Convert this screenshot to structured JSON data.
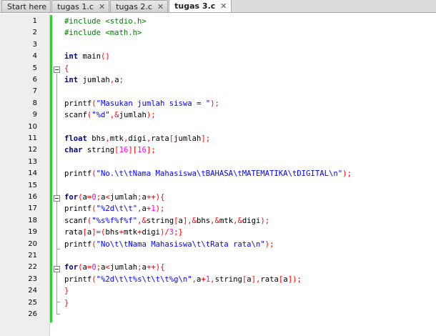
{
  "tabs": [
    {
      "label": "Start here",
      "active": false
    },
    {
      "label": "tugas 1.c",
      "active": false
    },
    {
      "label": "tugas 2.c",
      "active": false
    },
    {
      "label": "tugas 3.c",
      "active": true
    }
  ],
  "close_glyph": "✕",
  "editor": {
    "line_numbers": [
      "1",
      "2",
      "3",
      "4",
      "5",
      "6",
      "7",
      "8",
      "9",
      "10",
      "11",
      "12",
      "13",
      "14",
      "15",
      "16",
      "17",
      "18",
      "19",
      "20",
      "21",
      "22",
      "23",
      "24",
      "25",
      "26"
    ],
    "colors": {
      "keyword": "#00008b",
      "preprocessor": "#008000",
      "string": "#0000ff",
      "number": "#ff00ff",
      "operator": "#ff0000",
      "change_bar": "#33cc33",
      "gutter": "#eeeeee"
    },
    "code": {
      "l1": {
        "a": "#include <stdio.h>"
      },
      "l2": {
        "a": "#include <math.h>"
      },
      "l4": {
        "a": "int",
        "b": " main",
        "c": "()"
      },
      "l5": {
        "a": "{"
      },
      "l6": {
        "a": "int",
        "b": " jumlah",
        "c": ",",
        "d": "a",
        "e": ";"
      },
      "l8": {
        "a": "printf",
        "b": "(",
        "c": "\"Masukan jumlah siswa = \"",
        "d": ");"
      },
      "l9": {
        "a": "scanf",
        "b": "(",
        "c": "\"%d\"",
        "d": ",&",
        "e": "jumlah",
        "f": ");"
      },
      "l11": {
        "a": "float",
        "b": " bhs",
        "c": ",",
        "d": "mtk",
        "e": ",",
        "f": "digi",
        "g": ",",
        "h": "rata",
        "i": "[",
        "j": "jumlah",
        "k": "];"
      },
      "l12": {
        "a": "char",
        "b": " string",
        "c": "[",
        "d": "16",
        "e": "][",
        "f": "16",
        "g": "];"
      },
      "l14": {
        "a": "printf",
        "b": "(",
        "c": "\"No.\\t\\tNama Mahasiswa\\tBAHASA\\tMATEMATIKA\\tDIGITAL\\n\"",
        "d": ");"
      },
      "l16": {
        "a": "for",
        "b": "(",
        "c": "a",
        "d": "=",
        "e": "0",
        "f": ";",
        "g": "a",
        "h": "<",
        "i": "jumlah",
        "j": ";",
        "k": "a",
        "l": "++){"
      },
      "l17": {
        "a": "printf",
        "b": "(",
        "c": "\"%2d\\t\\t\"",
        "d": ",",
        "e": "a",
        "f": "+",
        "g": "1",
        "h": ");"
      },
      "l18": {
        "a": "scanf",
        "b": "(",
        "c": "\"%s%f%f%f\"",
        "d": ",&",
        "e": "string",
        "f": "[",
        "g": "a",
        "h": "],&",
        "i": "bhs",
        "j": ",&",
        "k": "mtk",
        "l": ",&",
        "m": "digi",
        "n": ");"
      },
      "l19": {
        "a": "rata",
        "b": "[",
        "c": "a",
        "d": "]=(",
        "e": "bhs",
        "f": "+",
        "g": "mtk",
        "h": "+",
        "i": "digi",
        "j": ")/",
        "k": "3",
        "l": ";}"
      },
      "l20": {
        "a": "printf",
        "b": "(",
        "c": "\"No\\t\\tNama Mahasiswa\\t\\tRata rata\\n\"",
        "d": ");"
      },
      "l22": {
        "a": "for",
        "b": "(",
        "c": "a",
        "d": "=",
        "e": "0",
        "f": ";",
        "g": "a",
        "h": "<",
        "i": "jumlah",
        "j": ";",
        "k": "a",
        "l": "++){"
      },
      "l23": {
        "a": "printf",
        "b": "(",
        "c": "\"%2d\\t\\t%s\\t\\t\\t%g\\n\"",
        "d": ",",
        "e": "a",
        "f": "+",
        "g": "1",
        "h": ",",
        "i": "string",
        "j": "[",
        "k": "a",
        "l": "],",
        "m": "rata",
        "n": "[",
        "o": "a",
        "p": "]);"
      },
      "l24": {
        "a": "}"
      },
      "l25": {
        "a": "}"
      }
    }
  }
}
